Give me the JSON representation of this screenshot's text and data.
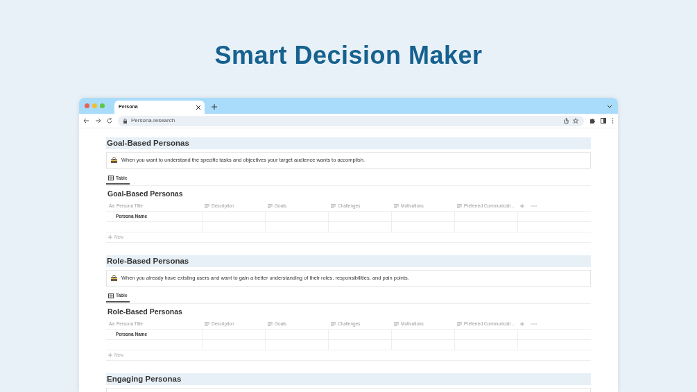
{
  "headline": "Smart Decision Maker",
  "browser": {
    "tab_title": "Persona",
    "address": "Persona.research"
  },
  "sections": [
    {
      "heading": "Goal-Based Personas",
      "callout": "When you want to understand the specific tasks and objectives your target audience wants to accomplish.",
      "view_tab": "Table",
      "table_title": "Goal-Based Personas",
      "columns": [
        {
          "kind": "title",
          "prefix": "Aa",
          "label": "Persona Title"
        },
        {
          "kind": "text",
          "label": "Description"
        },
        {
          "kind": "text",
          "label": "Goals"
        },
        {
          "kind": "text",
          "label": "Challenges"
        },
        {
          "kind": "text",
          "label": "Motivations"
        },
        {
          "kind": "text",
          "label": "Preferred Communicati..."
        }
      ],
      "rows": [
        [
          "Persona Name"
        ],
        []
      ],
      "new_label": "New"
    },
    {
      "heading": "Role-Based Personas",
      "callout": "When you already have existing users and want to gain a better understanding of their roles, responsibilities, and pain points.",
      "view_tab": "Table",
      "table_title": "Role-Based Personas",
      "columns": [
        {
          "kind": "title",
          "prefix": "Aa",
          "label": "Persona Title"
        },
        {
          "kind": "text",
          "label": "Description"
        },
        {
          "kind": "text",
          "label": "Goals"
        },
        {
          "kind": "text",
          "label": "Challenges"
        },
        {
          "kind": "text",
          "label": "Motivations"
        },
        {
          "kind": "text",
          "label": "Preferred Communicati..."
        }
      ],
      "rows": [
        [
          "Persona Name"
        ],
        []
      ],
      "new_label": "New"
    },
    {
      "heading": "Engaging Personas"
    }
  ]
}
